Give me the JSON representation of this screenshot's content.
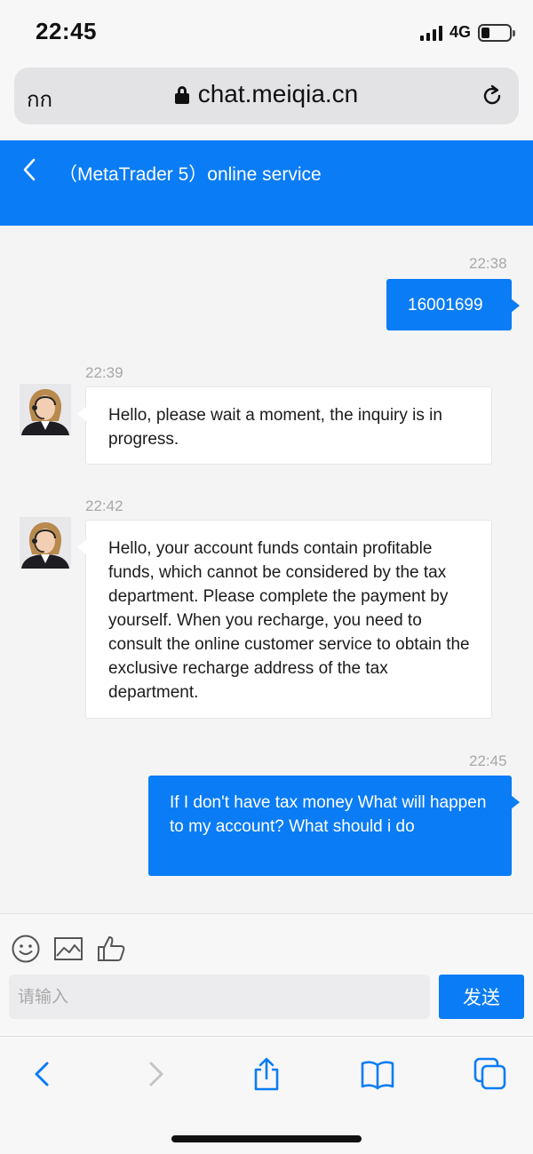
{
  "status_bar": {
    "time": "22:45",
    "network": "4G"
  },
  "browser": {
    "aa_label": "กก",
    "url": "chat.meiqia.cn"
  },
  "chat": {
    "title": "（MetaTrader 5）online service"
  },
  "messages": [
    {
      "from": "user",
      "time": "22:38",
      "text": "16001699"
    },
    {
      "from": "agent",
      "time": "22:39",
      "text": "Hello, please wait a moment, the inquiry is in progress."
    },
    {
      "from": "agent",
      "time": "22:42",
      "text": "Hello, your account funds contain profitable funds, which cannot be considered by the tax department. Please complete the payment by yourself. When you recharge, you need to consult the online customer service to obtain the exclusive recharge address of the tax department."
    },
    {
      "from": "user",
      "time": "22:45",
      "text": "If I don't have tax money What will happen to my account? What should i do"
    }
  ],
  "composer": {
    "placeholder": "请输入",
    "send_label": "发送"
  },
  "colors": {
    "accent": "#0a7cf5",
    "background": "#f4f4f5"
  }
}
